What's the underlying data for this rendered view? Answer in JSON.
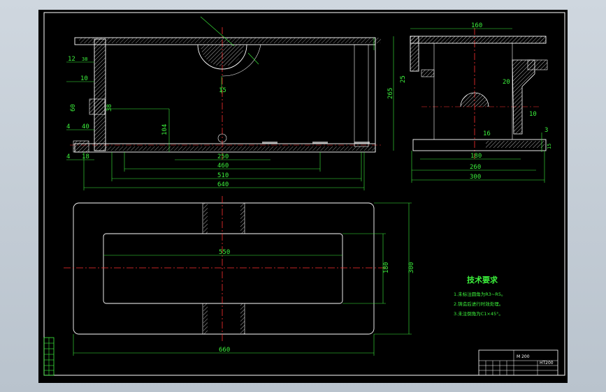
{
  "drawing": {
    "front_view": {
      "dims": {
        "d_12": "12",
        "d_38a": "38",
        "d_10": "10",
        "d_60": "60",
        "d_38b": "38",
        "d_104": "104",
        "d_40": "40",
        "d_18": "18",
        "d_4a": "4",
        "d_4b": "4",
        "d_15": "15",
        "d_250": "250",
        "d_460": "460",
        "d_510": "510",
        "d_640": "640"
      }
    },
    "side_view": {
      "dims": {
        "d_160top": "160",
        "d_25": "25",
        "d_265": "265",
        "d_20": "20",
        "d_10": "10",
        "d_16": "16",
        "d_3": "3",
        "d_180": "180",
        "d_260": "260",
        "d_300": "300",
        "d_15": "15"
      }
    },
    "top_view": {
      "dims": {
        "d_550": "550",
        "d_180": "180",
        "d_300": "300",
        "d_660": "660"
      }
    },
    "tech_requirements": {
      "title": "技术要求",
      "notes": [
        "1.未标注圆角为R3~R5。",
        "2.铸造后进行时效处理。",
        "3.未注倒角为C1×45°。"
      ]
    },
    "title_block": {
      "part_no": "M 200",
      "material": "HT200"
    }
  }
}
